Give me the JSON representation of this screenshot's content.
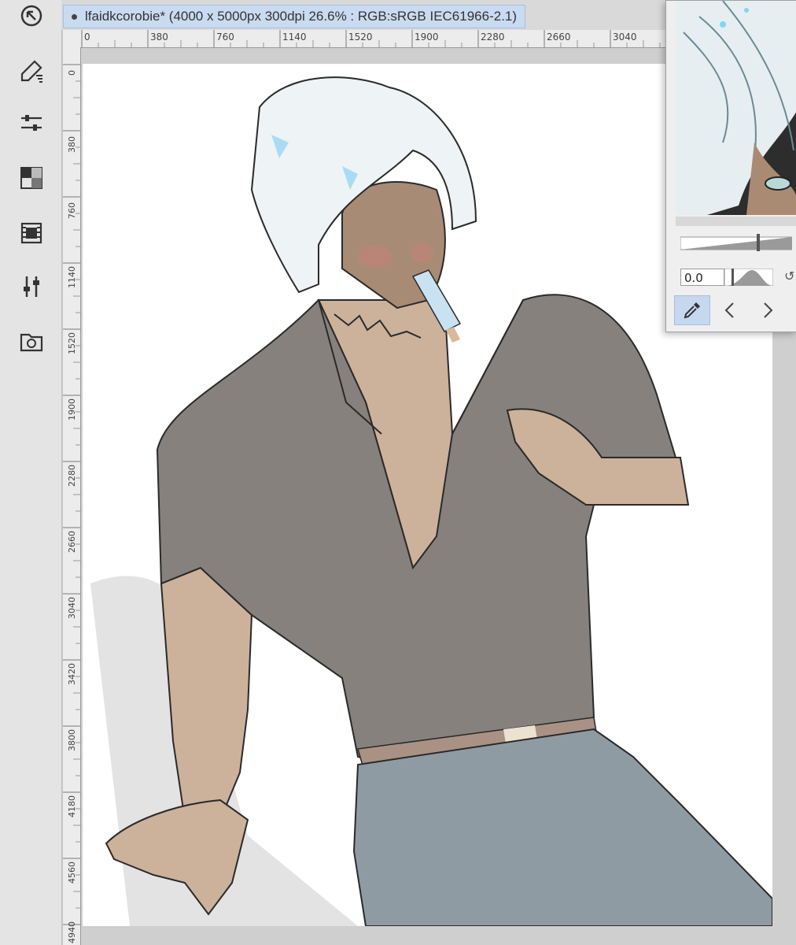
{
  "window": {
    "doc_tab_title": "lfaidkcorobie* (4000 x 5000px 300dpi 26.6% : RGB:sRGB IEC61966-2.1)"
  },
  "toolstrip": {
    "tools": [
      {
        "name": "navigator-tool-icon"
      },
      {
        "name": "brush-tool-icon"
      },
      {
        "name": "tool-property-icon"
      },
      {
        "name": "color-set-icon"
      },
      {
        "name": "timeline-icon"
      },
      {
        "name": "adjust-icon"
      },
      {
        "name": "material-folder-icon"
      }
    ]
  },
  "rulers": {
    "horizontal": [
      "0",
      "380",
      "760",
      "1140",
      "1520",
      "1900",
      "2280",
      "2660",
      "3040"
    ],
    "vertical": [
      "0",
      "380",
      "760",
      "1140",
      "1520",
      "1900",
      "2280",
      "2660",
      "3040",
      "3420",
      "3800",
      "4180",
      "4560",
      "4940"
    ]
  },
  "navigator": {
    "rotation_value": "0.0",
    "zoom_level": 0.7,
    "rotation_level": 0.15
  },
  "colors": {
    "accent": "#c8dbf0",
    "canvas": "#ffffff",
    "shirt": "#86817c",
    "skin": "#ccb19b",
    "jeans": "#8f9ba2",
    "hair": "#eef3f5"
  }
}
